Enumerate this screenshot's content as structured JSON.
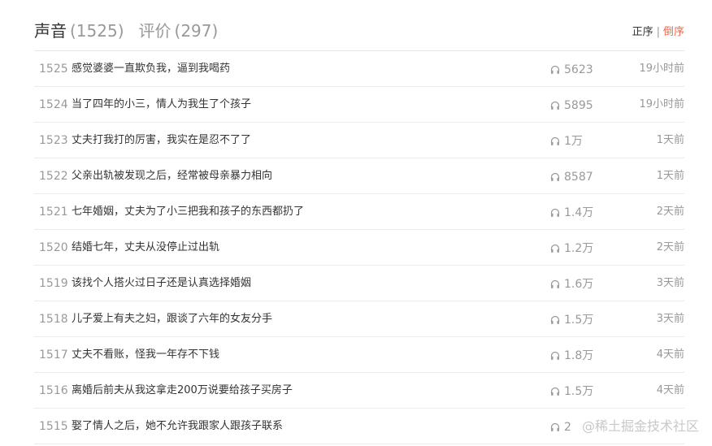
{
  "tabs": [
    {
      "name": "声音",
      "count": "(1525)",
      "active": true
    },
    {
      "name": "评价",
      "count": "(297)",
      "active": false
    }
  ],
  "sort": {
    "asc_label": "正序",
    "separator": "|",
    "desc_label": "倒序",
    "active_color": "#f86442"
  },
  "tracks": [
    {
      "index": "1525",
      "title": "感觉婆婆一直欺负我，逼到我喝药",
      "plays": "5623",
      "time": "19小时前"
    },
    {
      "index": "1524",
      "title": "当了四年的小三，情人为我生了个孩子",
      "plays": "5895",
      "time": "19小时前"
    },
    {
      "index": "1523",
      "title": "丈夫打我打的厉害，我实在是忍不了了",
      "plays": "1万",
      "time": "1天前"
    },
    {
      "index": "1522",
      "title": "父亲出轨被发现之后，经常被母亲暴力相向",
      "plays": "8587",
      "time": "1天前"
    },
    {
      "index": "1521",
      "title": "七年婚姻，丈夫为了小三把我和孩子的东西都扔了",
      "plays": "1.4万",
      "time": "2天前"
    },
    {
      "index": "1520",
      "title": "结婚七年，丈夫从没停止过出轨",
      "plays": "1.2万",
      "time": "2天前"
    },
    {
      "index": "1519",
      "title": "该找个人搭火过日子还是认真选择婚姻",
      "plays": "1.6万",
      "time": "3天前"
    },
    {
      "index": "1518",
      "title": "儿子爱上有夫之妇，跟谈了六年的女友分手",
      "plays": "1.5万",
      "time": "3天前"
    },
    {
      "index": "1517",
      "title": "丈夫不看账，怪我一年存不下钱",
      "plays": "1.8万",
      "time": "4天前"
    },
    {
      "index": "1516",
      "title": "离婚后前夫从我这拿走200万说要给孩子买房子",
      "plays": "1.5万",
      "time": "4天前"
    },
    {
      "index": "1515",
      "title": "娶了情人之后，她不允许我跟家人跟孩子联系",
      "plays": "2",
      "time": ""
    }
  ],
  "icons": {
    "plays": "headphones-icon"
  },
  "watermark": "@稀土掘金技术社区"
}
